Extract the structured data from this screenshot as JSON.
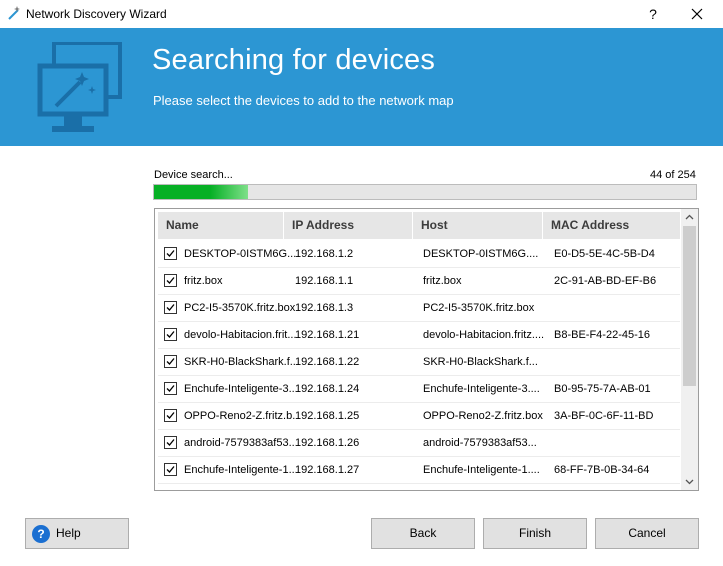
{
  "window": {
    "title": "Network Discovery Wizard",
    "help_glyph": "?",
    "close_icon": "close-icon",
    "app_icon": "magic-wand-icon"
  },
  "banner": {
    "heading": "Searching for devices",
    "subheading": "Please select the devices to add to the network map",
    "icon": "monitor-wand-icon",
    "background": "#2c96d3"
  },
  "progress": {
    "label": "Device search...",
    "count_text": "44 of 254",
    "fraction": 0.173,
    "color": "#06b025"
  },
  "table": {
    "columns": [
      "Name",
      "IP Address",
      "Host",
      "MAC Address"
    ],
    "rows": [
      {
        "checked": true,
        "name": "DESKTOP-0ISTM6G....",
        "ip": "192.168.1.2",
        "host": "DESKTOP-0ISTM6G....",
        "mac": "E0-D5-5E-4C-5B-D4"
      },
      {
        "checked": true,
        "name": "fritz.box",
        "ip": "192.168.1.1",
        "host": "fritz.box",
        "mac": "2C-91-AB-BD-EF-B6"
      },
      {
        "checked": true,
        "name": "PC2-I5-3570K.fritz.box",
        "ip": "192.168.1.3",
        "host": "PC2-I5-3570K.fritz.box",
        "mac": ""
      },
      {
        "checked": true,
        "name": "devolo-Habitacion.frit...",
        "ip": "192.168.1.21",
        "host": "devolo-Habitacion.fritz....",
        "mac": "B8-BE-F4-22-45-16"
      },
      {
        "checked": true,
        "name": "SKR-H0-BlackShark.f...",
        "ip": "192.168.1.22",
        "host": "SKR-H0-BlackShark.f...",
        "mac": ""
      },
      {
        "checked": true,
        "name": "Enchufe-Inteligente-3....",
        "ip": "192.168.1.24",
        "host": "Enchufe-Inteligente-3....",
        "mac": "B0-95-75-7A-AB-01"
      },
      {
        "checked": true,
        "name": "OPPO-Reno2-Z.fritz.b...",
        "ip": "192.168.1.25",
        "host": "OPPO-Reno2-Z.fritz.box",
        "mac": "3A-BF-0C-6F-11-BD"
      },
      {
        "checked": true,
        "name": "android-7579383af53...",
        "ip": "192.168.1.26",
        "host": "android-7579383af53...",
        "mac": ""
      },
      {
        "checked": true,
        "name": "Enchufe-Inteligente-1....",
        "ip": "192.168.1.27",
        "host": "Enchufe-Inteligente-1....",
        "mac": "68-FF-7B-0B-34-64"
      }
    ]
  },
  "buttons": {
    "help": "Help",
    "back": "Back",
    "finish": "Finish",
    "cancel": "Cancel"
  }
}
